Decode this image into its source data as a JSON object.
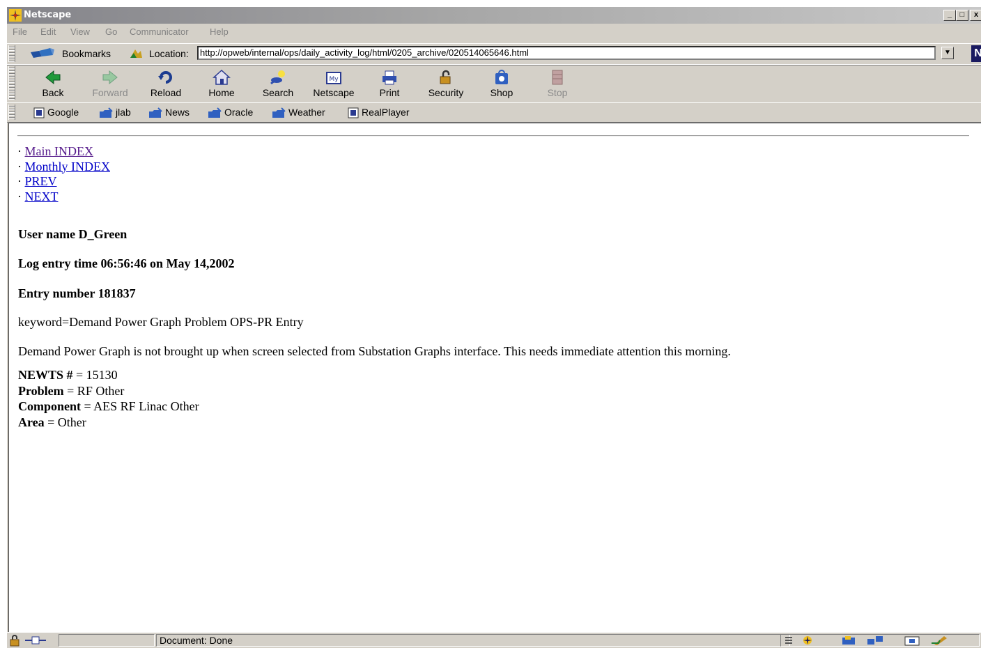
{
  "window": {
    "title": "Netscape"
  },
  "menu": [
    "File",
    "Edit",
    "View",
    "Go",
    "Communicator",
    "Help"
  ],
  "location": {
    "bookmarks_label": "Bookmarks",
    "location_label": "Location:",
    "url": "http://opweb/internal/ops/daily_activity_log/html/0205_archive/020514065646.html"
  },
  "nav": [
    {
      "label": "Back",
      "icon": "back-icon",
      "enabled": true
    },
    {
      "label": "Forward",
      "icon": "forward-icon",
      "enabled": false
    },
    {
      "label": "Reload",
      "icon": "reload-icon",
      "enabled": true
    },
    {
      "label": "Home",
      "icon": "home-icon",
      "enabled": true
    },
    {
      "label": "Search",
      "icon": "search-icon",
      "enabled": true
    },
    {
      "label": "Netscape",
      "icon": "my-netscape-icon",
      "enabled": true
    },
    {
      "label": "Print",
      "icon": "print-icon",
      "enabled": true
    },
    {
      "label": "Security",
      "icon": "lock-icon",
      "enabled": true
    },
    {
      "label": "Shop",
      "icon": "shop-icon",
      "enabled": true
    },
    {
      "label": "Stop",
      "icon": "stop-icon",
      "enabled": false
    }
  ],
  "personal": [
    {
      "label": "Google",
      "icon": "netscape-page-icon"
    },
    {
      "label": "jlab",
      "icon": "folder-icon"
    },
    {
      "label": "News",
      "icon": "folder-icon"
    },
    {
      "label": "Oracle",
      "icon": "folder-icon"
    },
    {
      "label": "Weather",
      "icon": "folder-icon"
    },
    {
      "label": "RealPlayer",
      "icon": "netscape-page-icon"
    }
  ],
  "page": {
    "bullet": "·",
    "links": [
      {
        "label": "Main INDEX",
        "visited": true
      },
      {
        "label": "Monthly INDEX",
        "visited": false
      },
      {
        "label": "PREV",
        "visited": false
      },
      {
        "label": "NEXT",
        "visited": false
      }
    ],
    "user_name": "User name D_Green",
    "log_time": "Log entry time 06:56:46 on May 14,2002",
    "entry_number": "Entry number 181837",
    "keyword": "keyword=Demand Power Graph Problem OPS-PR Entry",
    "description": "Demand Power Graph is not brought up when screen selected from Substation Graphs interface. This needs immediate attention this morning.",
    "fields": [
      {
        "label": "NEWTS #",
        "value": " = 15130"
      },
      {
        "label": "Problem",
        "value": " = RF Other"
      },
      {
        "label": "Component",
        "value": " = AES RF Linac Other"
      },
      {
        "label": "Area",
        "value": " = Other"
      }
    ]
  },
  "status": {
    "text": "Document: Done"
  },
  "colors": {
    "link": "#0000c8",
    "visited_link": "#551a8b",
    "chrome": "#d4d0c8"
  }
}
